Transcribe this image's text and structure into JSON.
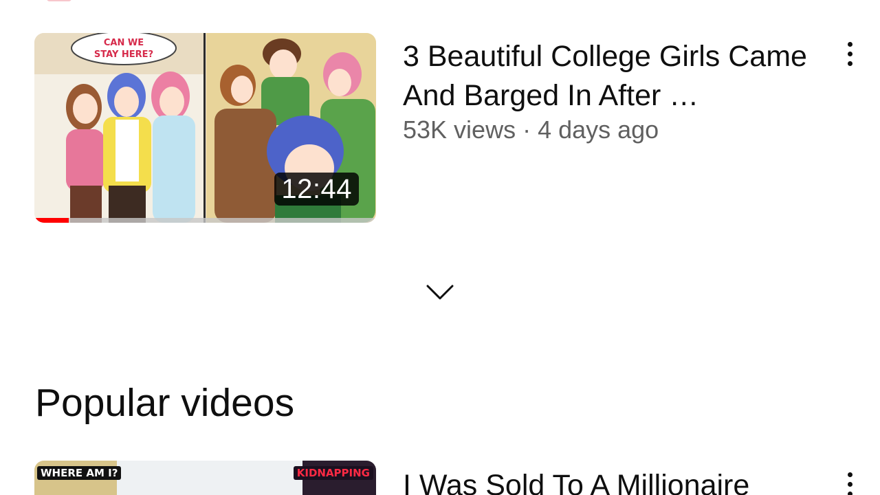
{
  "recent_videos": [
    {
      "title": "3 Beautiful College Girls Came And Barged In After …",
      "meta": "53K views · 4 days ago",
      "duration": "12:44",
      "watch_progress": 0.1,
      "thumbnail_text": "CAN WE STAY HERE?",
      "menu_icon": "more-vert-icon"
    }
  ],
  "expand": {
    "icon": "chevron-down-icon"
  },
  "section": {
    "title": "Popular videos"
  },
  "popular_videos": [
    {
      "title": "I Was Sold To A Millionaire",
      "thumbnail_tags": [
        "WHERE AM I?",
        "KIDNAPPING"
      ],
      "menu_icon": "more-vert-icon"
    }
  ],
  "colors": {
    "progress": "#ff0000",
    "meta_text": "#606060",
    "primary_text": "#0f0f0f"
  }
}
